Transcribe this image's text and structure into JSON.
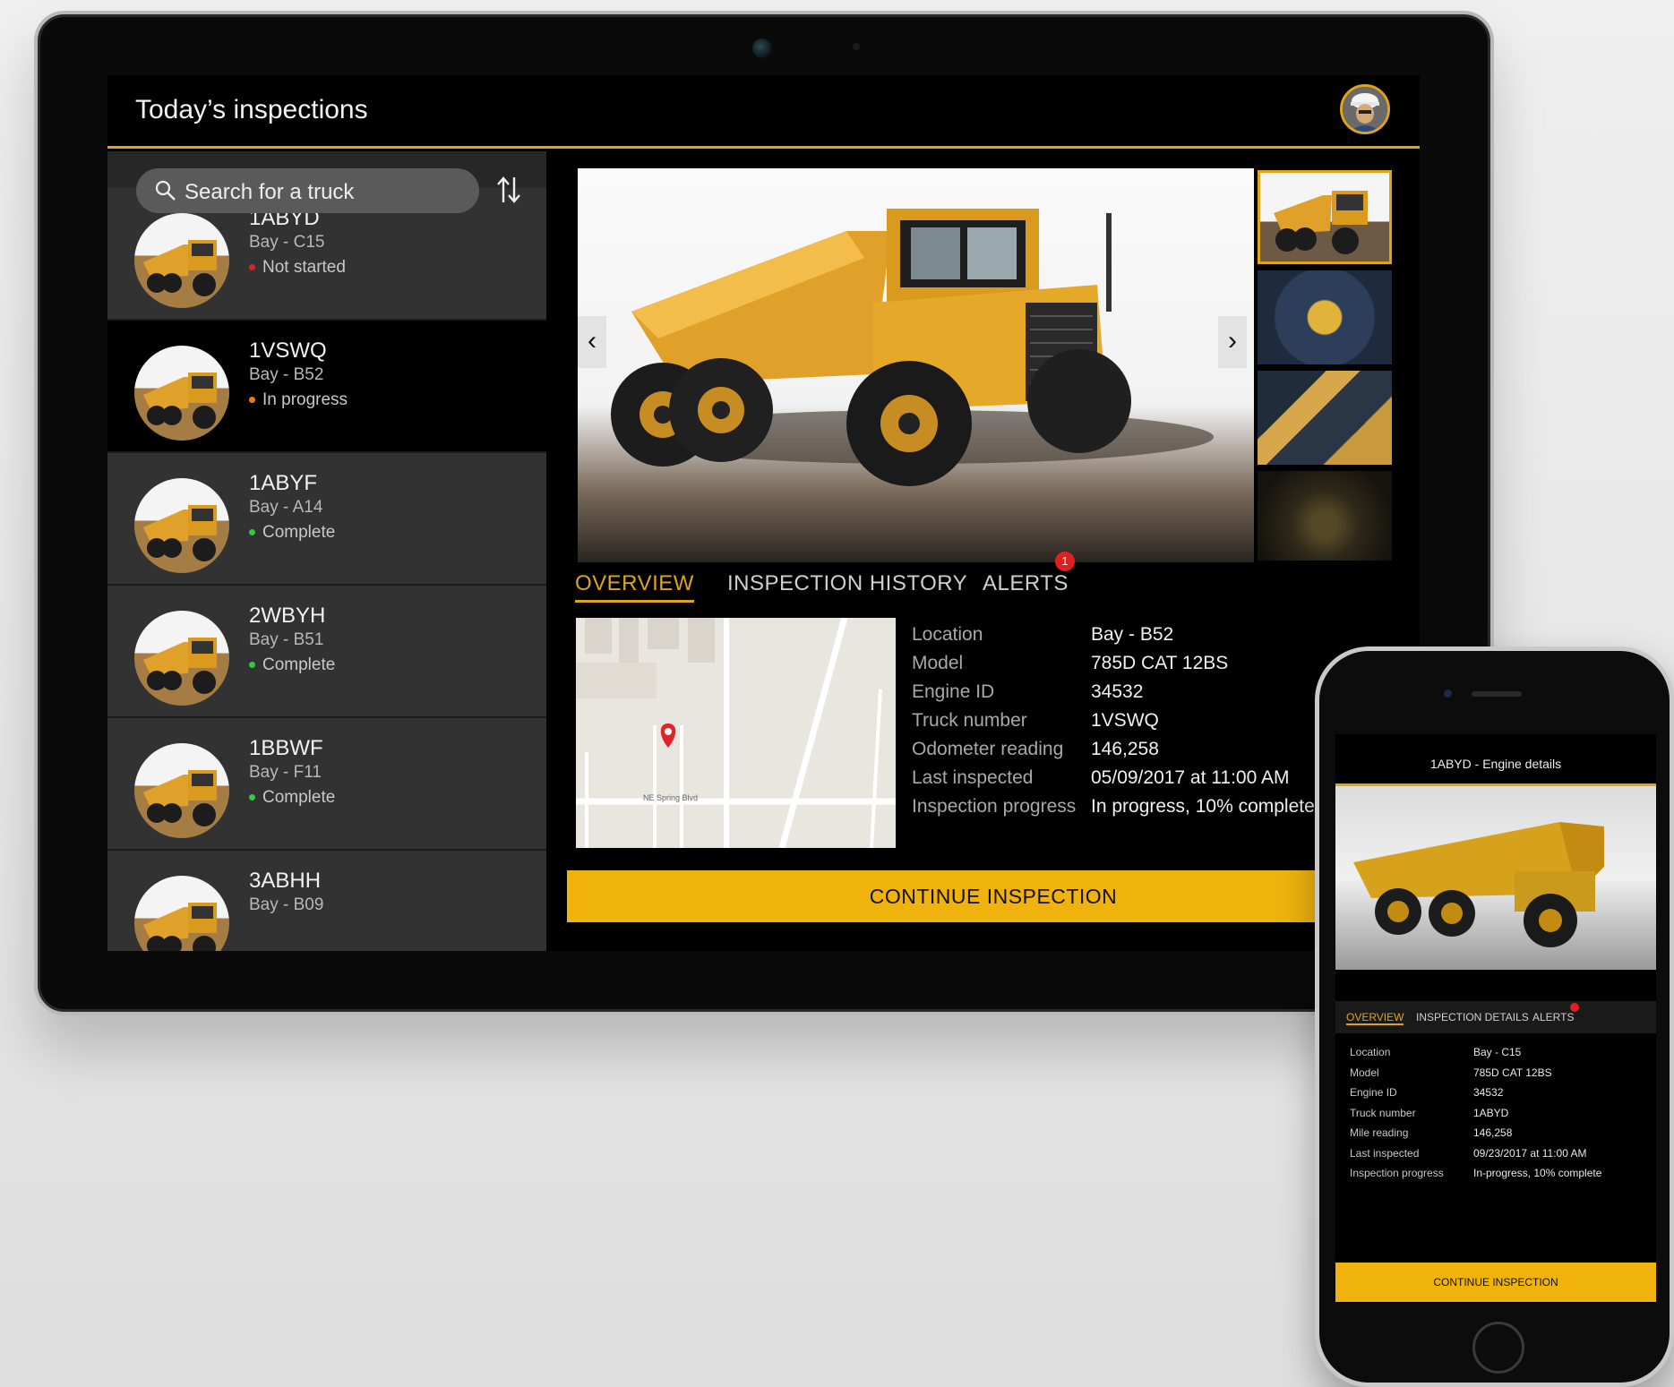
{
  "tablet": {
    "header": {
      "title": "Today’s inspections"
    },
    "search": {
      "placeholder": "Search for a truck"
    },
    "trucks": [
      {
        "id": "1ABYD",
        "bay": "Bay - C15",
        "status": "Not started",
        "status_color": "#e02020"
      },
      {
        "id": "1VSWQ",
        "bay": "Bay - B52",
        "status": "In progress",
        "status_color": "#f07a1a"
      },
      {
        "id": "1ABYF",
        "bay": "Bay - A14",
        "status": "Complete",
        "status_color": "#2ecc40"
      },
      {
        "id": "2WBYH",
        "bay": "Bay - B51",
        "status": "Complete",
        "status_color": "#2ecc40"
      },
      {
        "id": "1BBWF",
        "bay": "Bay - F11",
        "status": "Complete",
        "status_color": "#2ecc40"
      },
      {
        "id": "3ABHH",
        "bay": "Bay - B09",
        "status": "",
        "status_color": ""
      }
    ],
    "tabs": {
      "overview": "OVERVIEW",
      "history": "INSPECTION HISTORY",
      "alerts": "ALERTS",
      "alerts_badge": "1"
    },
    "details": [
      {
        "label": "Location",
        "value": "Bay - B52"
      },
      {
        "label": "Model",
        "value": "785D CAT 12BS"
      },
      {
        "label": "Engine ID",
        "value": "34532"
      },
      {
        "label": "Truck number",
        "value": "1VSWQ"
      },
      {
        "label": "Odometer reading",
        "value": "146,258"
      },
      {
        "label": "Last inspected",
        "value": "05/09/2017 at 11:00 AM"
      },
      {
        "label": "Inspection progress",
        "value": "In progress, 10% complete"
      }
    ],
    "map": {
      "street": "NE Spring Blvd"
    },
    "continue_label": "CONTINUE INSPECTION"
  },
  "phone": {
    "title": "1ABYD - Engine details",
    "tabs": {
      "overview": "OVERVIEW",
      "details": "INSPECTION DETAILS",
      "alerts": "ALERTS"
    },
    "details": [
      {
        "label": "Location",
        "value": "Bay - C15"
      },
      {
        "label": "Model",
        "value": "785D CAT 12BS"
      },
      {
        "label": "Engine ID",
        "value": "34532"
      },
      {
        "label": "Truck number",
        "value": "1ABYD"
      },
      {
        "label": "Mile reading",
        "value": "146,258"
      },
      {
        "label": "Last inspected",
        "value": "09/23/2017 at 11:00 AM"
      },
      {
        "label": "Inspection progress",
        "value": "In-progress, 10% complete"
      }
    ],
    "continue_label": "CONTINUE INSPECTION"
  },
  "colors": {
    "accent": "#e0a419",
    "button": "#f0b30e",
    "alert": "#e02020"
  },
  "icons": [
    "search-icon",
    "sort-icon",
    "chevron-left-icon",
    "chevron-right-icon",
    "map-pin-icon"
  ]
}
